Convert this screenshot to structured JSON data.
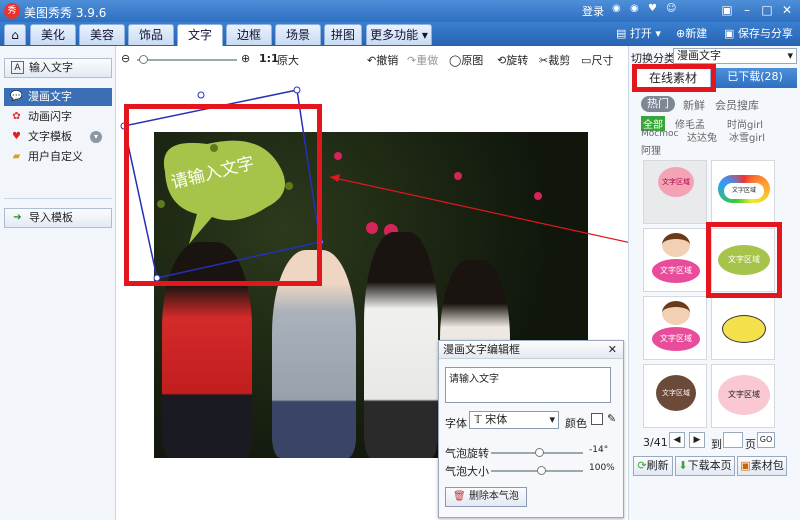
{
  "app": {
    "title": "美图秀秀 3.9.6",
    "login": "登录",
    "logo_char": "秀"
  },
  "menu": {
    "tabs": [
      "美化",
      "美容",
      "饰品",
      "文字",
      "边框",
      "场景",
      "拼图",
      "更多功能"
    ],
    "active": "文字",
    "open": "打开",
    "new": "新建",
    "save": "保存与分享"
  },
  "left": {
    "input_text": "输入文字",
    "items": [
      "漫画文字",
      "动画闪字",
      "文字模板",
      "用户自定义"
    ],
    "import": "导入模板"
  },
  "canvas": {
    "zoom_label": "1:1",
    "original_size": "原大",
    "undo": "撤销",
    "redo": "重做",
    "original": "原图",
    "rotate": "旋转",
    "crop": "裁剪",
    "size": "尺寸",
    "bubble_text": "请输入文字"
  },
  "right": {
    "category_label": "切换分类",
    "category_value": "漫画文字",
    "tab_online": "在线素材",
    "tab_downloaded": "已下载(28)",
    "filters": [
      "热门",
      "新鲜",
      "会员搜库"
    ],
    "tags": [
      "全部",
      "修毛孟",
      "时尚girl",
      "Mocmoc",
      "达达兔",
      "冰雪girl",
      "阿狸"
    ],
    "cell_text": "文字区域",
    "page": "3/41",
    "goto": "到",
    "page_unit": "页",
    "go": "GO",
    "refresh": "刷新",
    "download_page": "下载本页",
    "package": "素材包"
  },
  "dialog": {
    "title": "漫画文字编辑框",
    "text": "请输入文字",
    "font_label": "字体",
    "font_value": "宋体",
    "color_label": "颜色",
    "rotate_label": "气泡旋转",
    "rotate_value": "-14°",
    "size_label": "气泡大小",
    "size_value": "100%",
    "delete": "删除本气泡"
  },
  "colors": {
    "accent": "#2f6fc1",
    "highlight": "#e2161c",
    "bubble": "#a7c44a"
  }
}
